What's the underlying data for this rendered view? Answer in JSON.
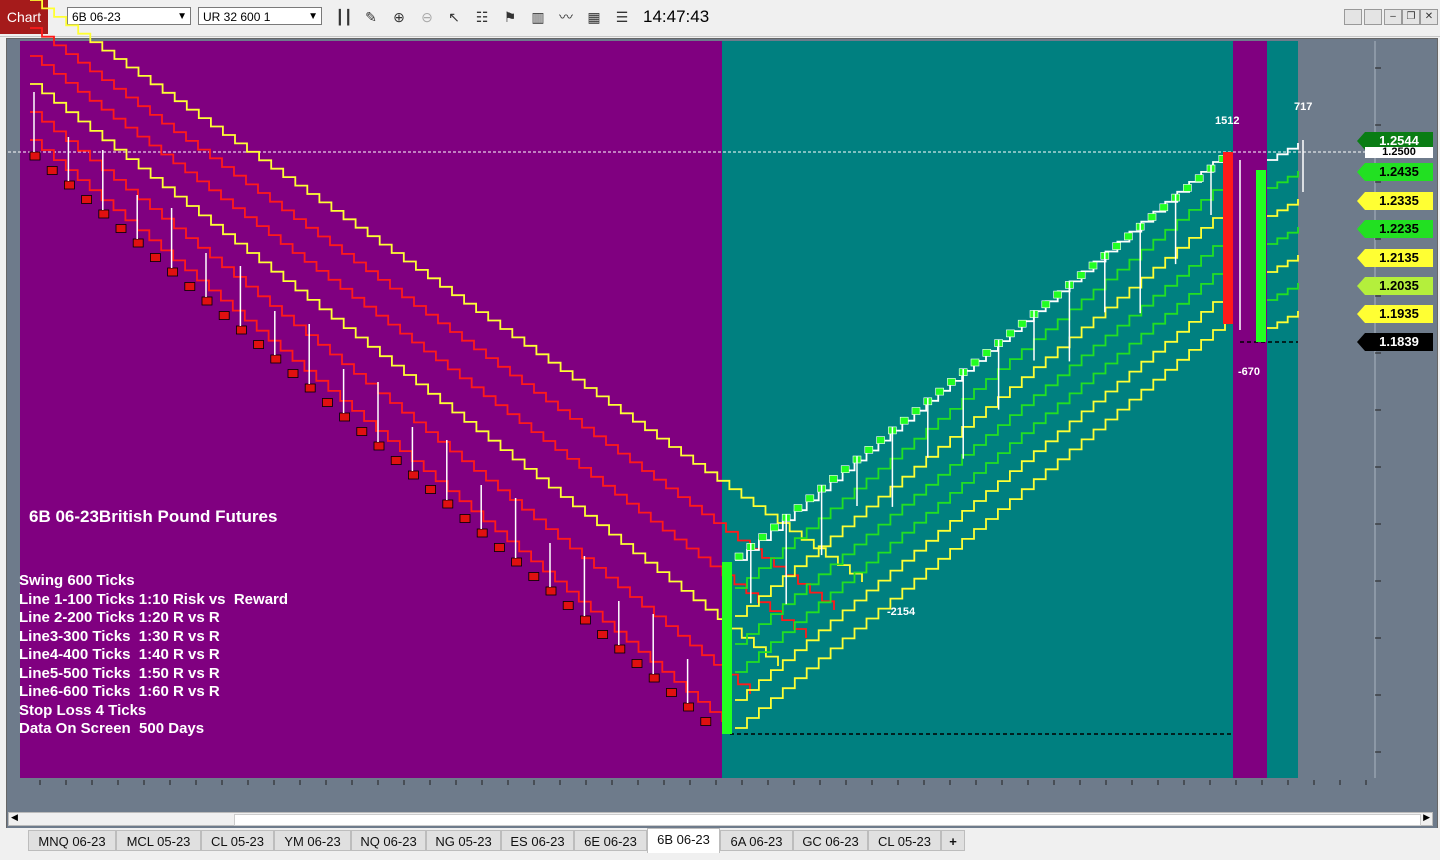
{
  "toolbar": {
    "chart_tab": "Chart",
    "symbol": "6B 06-23",
    "bar_type": "UR 32 600 1",
    "time": "14:47:43"
  },
  "chart": {
    "title": "6B 06-23British Pound Futures",
    "info_lines": [
      "Swing 600 Ticks",
      "Line 1-100 Ticks 1:10 Risk vs  Reward",
      "Line 2-200 Ticks 1:20 R vs R",
      "Line3-300 Ticks  1:30 R vs R",
      "Line4-400 Ticks  1:40 R vs R",
      "Line5-500 Ticks  1:50 R vs R",
      "Line6-600 Ticks  1:60 R vs R",
      "Stop Loss 4 Ticks",
      "Data On Screen  500 Days"
    ],
    "swing_labels": {
      "a": "1512",
      "b": "717",
      "c": "-670",
      "d": "-2154"
    },
    "price_labels": [
      {
        "value": "1.2544",
        "bg": "#0a7d14",
        "fg": "#ffffff"
      },
      {
        "value": "1.2500",
        "bg": "#ffffff",
        "fg": "#000000"
      },
      {
        "value": "1.2435",
        "bg": "#22e022",
        "fg": "#000000"
      },
      {
        "value": "1.2335",
        "bg": "#ffff33",
        "fg": "#000000"
      },
      {
        "value": "1.2235",
        "bg": "#22e022",
        "fg": "#000000"
      },
      {
        "value": "1.2135",
        "bg": "#ffff33",
        "fg": "#000000"
      },
      {
        "value": "1.2035",
        "bg": "#b4ef3c",
        "fg": "#000000"
      },
      {
        "value": "1.1935",
        "bg": "#ffff33",
        "fg": "#000000"
      },
      {
        "value": "1.1839",
        "bg": "#000000",
        "fg": "#ffffff"
      }
    ],
    "colors": {
      "down_zone": "#800080",
      "up_zone": "#008080",
      "right_zone": "#6e7b8b",
      "red_line": "#ff1a1a",
      "yellow_line": "#ffff33",
      "green_line": "#22e022",
      "white_line": "#ffffff"
    }
  },
  "tabs": [
    "MNQ 06-23",
    "MCL 05-23",
    "CL 05-23",
    "YM 06-23",
    "NQ 06-23",
    "NG 05-23",
    "ES 06-23",
    "6E 06-23",
    "6B 06-23",
    "6A 06-23",
    "GC 06-23",
    "CL 05-23",
    "+"
  ],
  "active_tab": "6B 06-23"
}
